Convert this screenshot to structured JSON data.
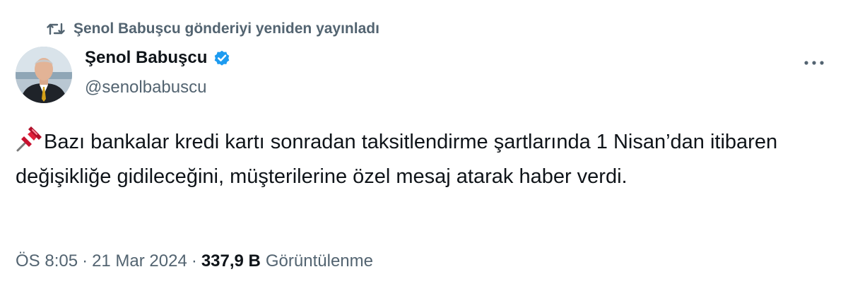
{
  "retweet": {
    "icon": "retweet-icon",
    "text": "Şenol Babuşcu gönderiyi yeniden yayınladı"
  },
  "author": {
    "name": "Şenol Babuşcu",
    "handle": "@senolbabuscu",
    "verified_icon": "verified-badge-icon",
    "verified_color": "#1d9bf0"
  },
  "menu": {
    "icon": "more-options-icon"
  },
  "tweet": {
    "emoji": "pushpin-icon",
    "text": "Bazı bankalar kredi kartı sonradan taksitlendirme şartlarında 1 Nisan’dan itibaren değişikliğe gidileceğini, müşterilerine özel mesaj atarak haber verdi."
  },
  "meta": {
    "time": "ÖS 8:05",
    "separator": "·",
    "date": "21 Mar 2024",
    "views_count": "337,9 B",
    "views_label": "Görüntülenme"
  },
  "colors": {
    "text_primary": "#0f1419",
    "text_secondary": "#536471",
    "accent": "#1d9bf0"
  }
}
